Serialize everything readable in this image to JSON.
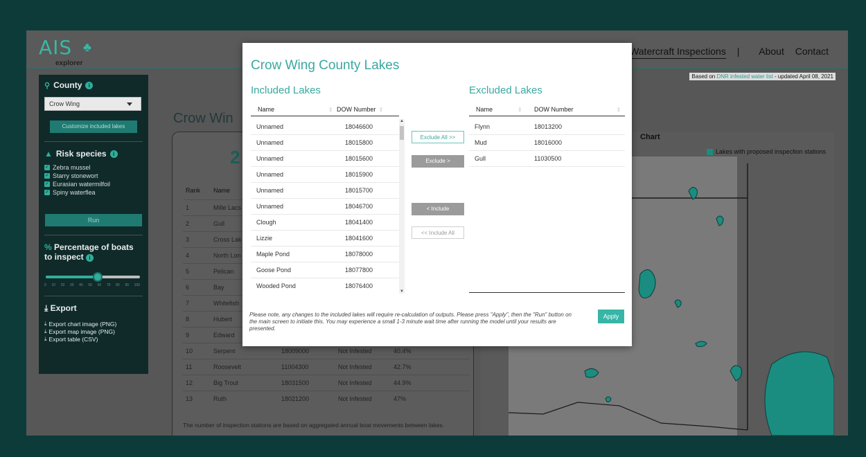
{
  "header": {
    "logo_text": "AIS",
    "logo_sub": "explorer",
    "nav_current": "ration for Watercraft Inspections",
    "nav_links": [
      "About",
      "Contact"
    ],
    "dnr_note_prefix": "Based on ",
    "dnr_note_link": "DNR infested water list",
    "dnr_note_suffix": " - updated April 08, 2021"
  },
  "sidebar": {
    "county_label": "County",
    "county_value": "Crow Wing",
    "customize_button": "Customize included lakes",
    "risk_label": "Risk species",
    "species": [
      "Zebra mussel",
      "Starry stonewort",
      "Eurasian watermilfoil",
      "Spiny waterflea"
    ],
    "run_button": "Run",
    "pct_label": "Percentage of boats to inspect",
    "pct_value": 55,
    "ticks": [
      "0",
      "10",
      "20",
      "30",
      "40",
      "50",
      "60",
      "70",
      "80",
      "90",
      "100"
    ],
    "export_label": "Export",
    "export_items": [
      "Export chart image (PNG)",
      "Export map image (PNG)",
      "Export table (CSV)"
    ]
  },
  "main": {
    "county_title": "Crow Win",
    "big_number": "2",
    "table_headers": [
      "Rank",
      "Name"
    ],
    "rows": [
      {
        "rank": "1",
        "name": "Mille Lacs",
        "dow": "",
        "status": "",
        "pct": ""
      },
      {
        "rank": "2",
        "name": "Gull",
        "dow": "",
        "status": "",
        "pct": ""
      },
      {
        "rank": "3",
        "name": "Cross Lak",
        "dow": "",
        "status": "",
        "pct": ""
      },
      {
        "rank": "4",
        "name": "North Lon",
        "dow": "",
        "status": "",
        "pct": ""
      },
      {
        "rank": "5",
        "name": "Pelican",
        "dow": "",
        "status": "",
        "pct": ""
      },
      {
        "rank": "6",
        "name": "Bay",
        "dow": "",
        "status": "",
        "pct": ""
      },
      {
        "rank": "7",
        "name": "Whitefish",
        "dow": "",
        "status": "",
        "pct": ""
      },
      {
        "rank": "8",
        "name": "Hubert",
        "dow": "",
        "status": "",
        "pct": ""
      },
      {
        "rank": "9",
        "name": "Edward",
        "dow": "18030500",
        "status": "Not Infested",
        "pct": "37.9%"
      },
      {
        "rank": "10",
        "name": "Serpent",
        "dow": "18009000",
        "status": "Not Infested",
        "pct": "40.4%"
      },
      {
        "rank": "11",
        "name": "Roosevelt",
        "dow": "11004300",
        "status": "Not Infested",
        "pct": "42.7%"
      },
      {
        "rank": "12",
        "name": "Big Trout",
        "dow": "18031500",
        "status": "Not Infested",
        "pct": "44.9%"
      },
      {
        "rank": "13",
        "name": "Ruth",
        "dow": "18021200",
        "status": "Not Infested",
        "pct": "47%"
      }
    ],
    "footnote": "The number of inspection stations are based on aggregated annual boat movements between lakes.",
    "chart_label": "Chart",
    "legend_label": "Lakes with proposed inspection stations"
  },
  "modal": {
    "title": "Crow Wing County Lakes",
    "included_title": "Included Lakes",
    "excluded_title": "Excluded Lakes",
    "col_name": "Name",
    "col_dow": "DOW Number",
    "included": [
      {
        "name": "Unnamed",
        "dow": "18046600"
      },
      {
        "name": "Unnamed",
        "dow": "18015800"
      },
      {
        "name": "Unnamed",
        "dow": "18015600"
      },
      {
        "name": "Unnamed",
        "dow": "18015900"
      },
      {
        "name": "Unnamed",
        "dow": "18015700"
      },
      {
        "name": "Unnamed",
        "dow": "18046700"
      },
      {
        "name": "Clough",
        "dow": "18041400"
      },
      {
        "name": "Lizzie",
        "dow": "18041600"
      },
      {
        "name": "Maple Pond",
        "dow": "18078000"
      },
      {
        "name": "Goose Pond",
        "dow": "18077800"
      },
      {
        "name": "Wooded Pond",
        "dow": "18076400"
      }
    ],
    "excluded": [
      {
        "name": "Flynn",
        "dow": "18013200"
      },
      {
        "name": "Mud",
        "dow": "18016000"
      },
      {
        "name": "Gull",
        "dow": "11030500"
      }
    ],
    "btn_exclude_all": "Exclude All >>",
    "btn_exclude": "Exclude >",
    "btn_include": "< Include",
    "btn_include_all": "<< Include All",
    "note": "Please note, any changes to the included lakes will require re-calculation of outputs. Please press \"Apply\", then the \"Run\" button on the main screen to initiate this. You may experience a small 1-3 minute wait time after running the model until your results are presented.",
    "apply": "Apply"
  },
  "colors": {
    "accent": "#3aa8a0",
    "sidebar": "#0f2a29",
    "backdrop": "#0d3b3a"
  }
}
